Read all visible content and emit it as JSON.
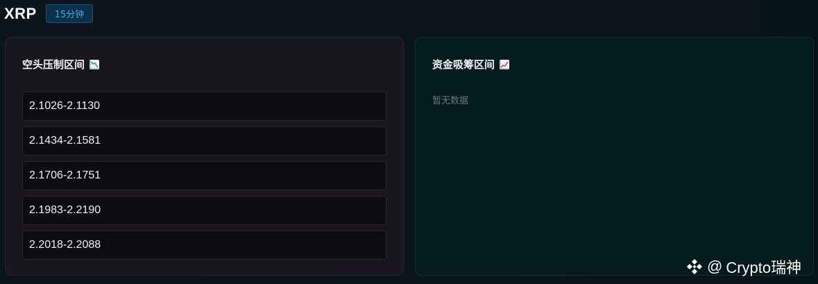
{
  "header": {
    "symbol": "XRP",
    "timeframe": "15分钟"
  },
  "bear_panel": {
    "title": "空头压制区间",
    "title_icon": "chart-decreasing-icon",
    "zones": [
      "2.1026-2.1130",
      "2.1434-2.1581",
      "2.1706-2.1751",
      "2.1983-2.2190",
      "2.2018-2.2088"
    ]
  },
  "bull_panel": {
    "title": "资金吸筹区间",
    "title_icon": "chart-increasing-icon",
    "empty_text": "暂无数据"
  },
  "watermark": {
    "at_sign": "@",
    "handle": "Crypto瑞神",
    "logo_icon": "binance-logo-icon"
  },
  "colors": {
    "badge_text": "#3aa9ea",
    "bear_border": "#3a1f26",
    "bull_bg": "#051c1e"
  }
}
